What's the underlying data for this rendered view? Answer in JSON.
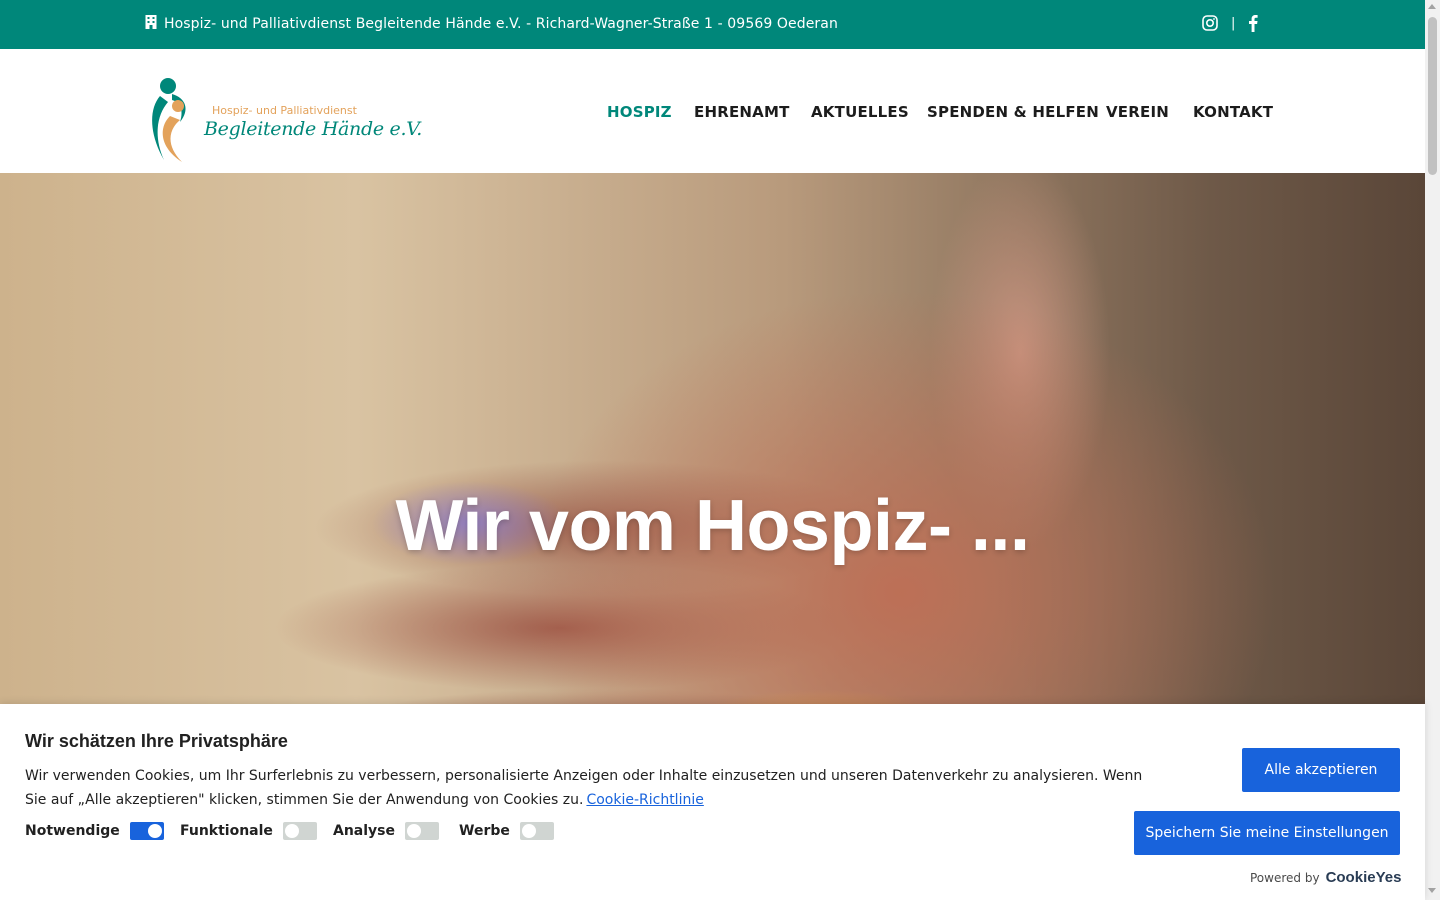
{
  "topbar": {
    "address": "Hospiz- und Palliativdienst Begleitende Hände e.V. - Richard-Wagner-Straße 1 - 09569 Oederan",
    "separator": "|",
    "icons": [
      "building-icon",
      "instagram-icon",
      "facebook-icon"
    ]
  },
  "logo": {
    "line1": "Hospiz- und Palliativdienst",
    "line2": "Begleitende Hände e.V."
  },
  "nav": {
    "items": [
      {
        "label": "HOSPIZ",
        "active": true
      },
      {
        "label": "EHRENAMT",
        "active": false
      },
      {
        "label": "AKTUELLES",
        "active": false
      },
      {
        "label": "SPENDEN & HELFEN",
        "active": false
      },
      {
        "label": "VEREIN",
        "active": false
      },
      {
        "label": "KONTAKT",
        "active": false
      }
    ]
  },
  "hero": {
    "title": "Wir vom Hospiz- ..."
  },
  "cookie": {
    "title": "Wir schätzen Ihre Privatsphäre",
    "text": "Wir verwenden Cookies, um Ihr Surferlebnis zu verbessern, personalisierte Anzeigen oder Inhalte einzusetzen und unseren Datenverkehr zu analysieren. Wenn Sie auf „Alle akzeptieren\" klicken, stimmen Sie der Anwendung von Cookies zu.",
    "link": "Cookie-Richtlinie",
    "toggles": [
      {
        "label": "Notwendige",
        "on": true
      },
      {
        "label": "Funktionale",
        "on": false
      },
      {
        "label": "Analyse",
        "on": false
      },
      {
        "label": "Werbe",
        "on": false
      }
    ],
    "accept_label": "Alle akzeptieren",
    "save_label": "Speichern Sie meine Einstellungen",
    "powered_by": "Powered by",
    "brand": "CookieYes"
  },
  "colors": {
    "brand_teal": "#00877a",
    "logo_orange": "#e3a25b",
    "button_blue": "#1863dc"
  }
}
